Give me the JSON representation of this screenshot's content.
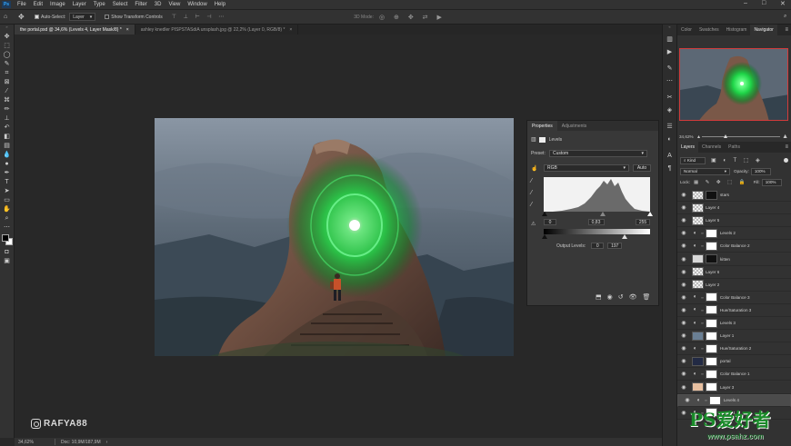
{
  "menubar": {
    "logo": "Ps",
    "items": [
      "File",
      "Edit",
      "Image",
      "Layer",
      "Type",
      "Select",
      "Filter",
      "3D",
      "View",
      "Window",
      "Help"
    ],
    "window_controls": [
      "–",
      "□",
      "✕"
    ]
  },
  "optionsbar": {
    "auto_select_label": "Auto-Select:",
    "auto_select_value": "Layer",
    "show_transform_label": "Show Transform Controls",
    "mode_3d_label": "3D Mode:"
  },
  "doc_tabs": [
    {
      "label": "the portal.psd @ 34,6% (Levels 4, Layer Mask/8) *",
      "active": true
    },
    {
      "label": "ashley knedler PISPSTASdiA unsplash.jpg @ 22,2% (Layer 0, RGB/8) *",
      "active": false
    }
  ],
  "status": {
    "zoom": "34,62%",
    "doc": "Doc: 10,9M/187,9M"
  },
  "watermark": {
    "handle": "RAFYA88"
  },
  "properties": {
    "tabs": [
      "Properties",
      "Adjustments"
    ],
    "panel_label": "Levels",
    "preset_label": "Preset:",
    "preset_value": "Custom",
    "channel_value": "RGB",
    "auto_label": "Auto",
    "input_black": "0",
    "input_gamma": "0,83",
    "input_white": "255",
    "output_label": "Output Levels:",
    "output_black": "0",
    "output_white": "197"
  },
  "right_tabs_top": [
    "Color",
    "Swatches",
    "Histogram",
    "Navigator"
  ],
  "navigator": {
    "zoom": "34,62%"
  },
  "layers_panel": {
    "tabs": [
      "Layers",
      "Channels",
      "Paths"
    ],
    "kind_label": "Kind",
    "blend_mode": "Normal",
    "opacity_label": "Opacity:",
    "opacity_value": "100%",
    "lock_label": "Lock:",
    "fill_label": "Fill:",
    "fill_value": "100%",
    "layers": [
      {
        "name": "stars",
        "type": "pixel"
      },
      {
        "name": "Layer 4",
        "type": "pixel"
      },
      {
        "name": "Layer 5",
        "type": "pixel"
      },
      {
        "name": "Levels 2",
        "type": "adj"
      },
      {
        "name": "Color Balance 2",
        "type": "adj"
      },
      {
        "name": "kitten",
        "type": "pixel"
      },
      {
        "name": "Layer 6",
        "type": "pixel"
      },
      {
        "name": "Layer 2",
        "type": "pixel"
      },
      {
        "name": "Color Balance 3",
        "type": "adj"
      },
      {
        "name": "Hue/Saturation 3",
        "type": "adj"
      },
      {
        "name": "Levels 3",
        "type": "adj"
      },
      {
        "name": "Layer 1",
        "type": "pixel"
      },
      {
        "name": "Hue/Saturation 2",
        "type": "adj"
      },
      {
        "name": "portal",
        "type": "pixel"
      },
      {
        "name": "Color Balance 1",
        "type": "adj"
      },
      {
        "name": "Layer 3",
        "type": "pixel"
      },
      {
        "name": "Levels 4",
        "type": "adj"
      },
      {
        "name": "Levels 1",
        "type": "adj"
      }
    ]
  },
  "site_logo": {
    "text": "PS爱好者",
    "url": "www.psahz.com"
  },
  "colors": {
    "accent_red": "#d23b3b",
    "glow_green": "#29ff5a"
  }
}
